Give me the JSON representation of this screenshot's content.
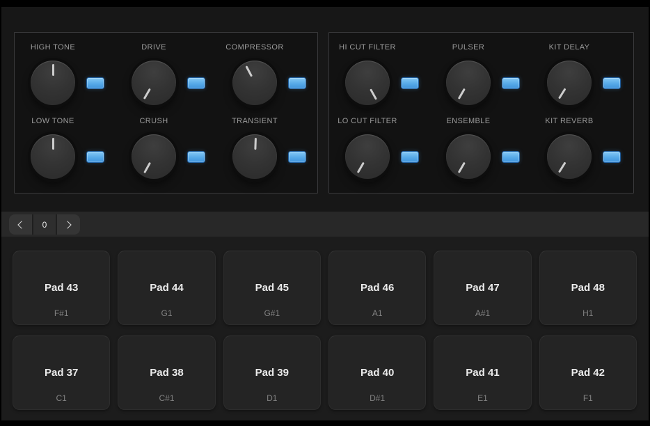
{
  "accent_color": "#57aae8",
  "panels": [
    {
      "knobs": [
        {
          "label": "HIGH TONE",
          "angle": 0
        },
        {
          "label": "DRIVE",
          "angle": -150
        },
        {
          "label": "COMPRESSOR",
          "angle": -28
        },
        {
          "label": "LOW TONE",
          "angle": 0
        },
        {
          "label": "CRUSH",
          "angle": -151
        },
        {
          "label": "TRANSIENT",
          "angle": 2
        }
      ]
    },
    {
      "knobs": [
        {
          "label": "HI CUT FILTER",
          "angle": 151
        },
        {
          "label": "PULSER",
          "angle": -150
        },
        {
          "label": "KIT DELAY",
          "angle": -148
        },
        {
          "label": "LO CUT FILTER",
          "angle": -150
        },
        {
          "label": "ENSEMBLE",
          "angle": -150
        },
        {
          "label": "KIT REVERB",
          "angle": -148
        }
      ]
    }
  ],
  "pager": {
    "value": "0",
    "prev_icon": "chevron-left",
    "next_icon": "chevron-right"
  },
  "pads": [
    {
      "name": "Pad 43",
      "note": "F#1"
    },
    {
      "name": "Pad 44",
      "note": "G1"
    },
    {
      "name": "Pad 45",
      "note": "G#1"
    },
    {
      "name": "Pad 46",
      "note": "A1"
    },
    {
      "name": "Pad 47",
      "note": "A#1"
    },
    {
      "name": "Pad 48",
      "note": "H1"
    },
    {
      "name": "Pad 37",
      "note": "C1"
    },
    {
      "name": "Pad 38",
      "note": "C#1"
    },
    {
      "name": "Pad 39",
      "note": "D1"
    },
    {
      "name": "Pad 40",
      "note": "D#1"
    },
    {
      "name": "Pad 41",
      "note": "E1"
    },
    {
      "name": "Pad 42",
      "note": "F1"
    }
  ]
}
